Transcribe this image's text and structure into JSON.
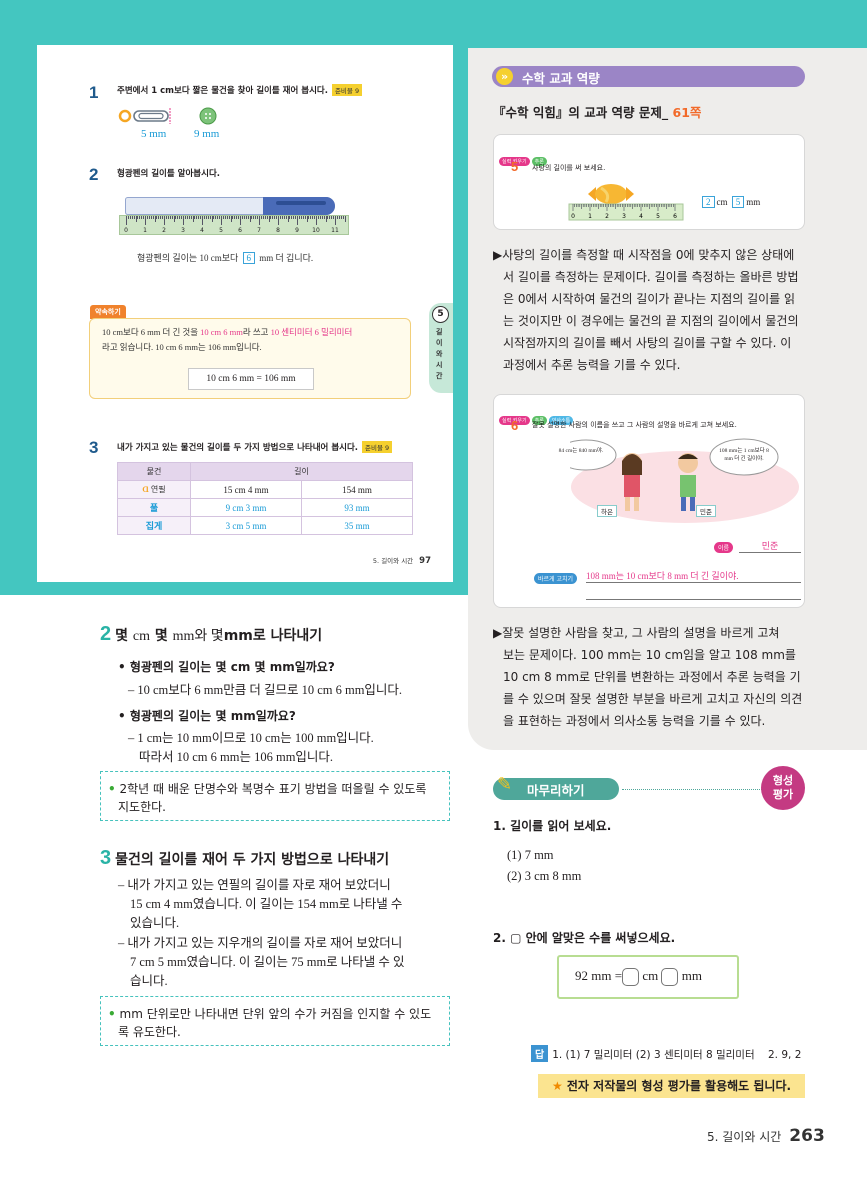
{
  "textbook": {
    "q1": {
      "num": "1",
      "text": "주변에서 1 cm보다 짧은 물건을 찾아 길이를 재어 봅시다.",
      "tag": "준비물 9",
      "label_a": "5 mm",
      "label_b": "9 mm"
    },
    "q2": {
      "num": "2",
      "text": "형광펜의 길이를 알아봅시다.",
      "ruler_numbers": [
        "0",
        "1",
        "2",
        "3",
        "4",
        "5",
        "6",
        "7",
        "8",
        "9",
        "10",
        "11"
      ],
      "sentence_pre": "형광펜의 길이는 10 cm보다",
      "sentence_box": "6",
      "sentence_post": "mm 더 깁니다."
    },
    "chapter_tab": {
      "num": "5",
      "text": "길이와시간"
    },
    "memo": {
      "tag": "약속하기",
      "line1_pre": "10 cm보다 6 mm 더 긴 것을",
      "line1_pink1": "10 cm 6 mm",
      "line1_mid": "라 쓰고",
      "line1_pink2": "10 센티미터 6 밀리미터",
      "line2": "라고 읽습니다. 10 cm 6 mm는 106 mm입니다.",
      "box": "10 cm 6 mm = 106 mm"
    },
    "q3": {
      "num": "3",
      "text": "내가 가지고 있는 물건의 길이를 두 가지 방법으로 나타내어 봅시다.",
      "tag": "준비물 9"
    },
    "table": {
      "headers": [
        "물건",
        "길이"
      ],
      "rows": [
        {
          "item": "연필",
          "a": "15 cm 4 mm",
          "b": "154 mm"
        },
        {
          "item": "풀",
          "a": "9 cm 3 mm",
          "b": "93 mm"
        },
        {
          "item": "집게",
          "a": "3 cm 5 mm",
          "b": "35 mm"
        }
      ]
    },
    "footer": {
      "chapter": "5. 길이와 시간",
      "page": "97"
    }
  },
  "left": {
    "sec2": {
      "num": "2",
      "title_a": "몇",
      "title_b": "cm",
      "title_c": "몇",
      "title_d": "mm와 몇",
      "title_e": "mm로 나타내기"
    },
    "b1": "• 형광펜의 길이는 몇 cm 몇 mm일까요?",
    "b1_ans": "– 10 cm보다 6 mm만큼 더 길므로 10 cm 6 mm입니다.",
    "b2": "• 형광펜의 길이는 몇 mm일까요?",
    "b2_ans1": "– 1 cm는 10 mm이므로 10 cm는 100 mm입니다.",
    "b2_ans2": "따라서 10 cm 6 mm는 106 mm입니다.",
    "note1_l1": "2학년 때 배운 단명수와 복명수 표기 방법을 떠올릴 수 있도록",
    "note1_l2": "지도한다.",
    "sec3": {
      "num": "3",
      "title": "물건의 길이를 재어 두 가지 방법으로 나타내기"
    },
    "s3_l1": "– 내가 가지고 있는 연필의 길이를 자로 재어 보았더니",
    "s3_l2": "15 cm 4 mm였습니다. 이 길이는 154 mm로 나타낼 수",
    "s3_l3": "있습니다.",
    "s3_l4": "– 내가 가지고 있는 지우개의 길이를 자로 재어 보았더니",
    "s3_l5": "7 cm 5 mm였습니다. 이 길이는 75 mm로 나타낼 수 있",
    "s3_l6": "습니다.",
    "note2_l1": "mm 단위로만 나타내면 단위 앞의 수가 커짐을 인지할 수 있도",
    "note2_l2": "록 유도한다."
  },
  "right": {
    "comp_label": "수학 교과 역량",
    "title_pre": "『수학 익힘』의 교과 역량 문제_",
    "title_page": "61쪽",
    "card1": {
      "num": "5",
      "tag1": "실력 키우기",
      "tag2": "추론",
      "q": "사탕의 길이를 써 보세요.",
      "ans_a": "2",
      "ans_b": "cm",
      "ans_c": "5",
      "ans_d": "mm",
      "ruler_numbers": [
        "0",
        "1",
        "2",
        "3",
        "4",
        "5",
        "6"
      ]
    },
    "para1": [
      "▶사탕의 길이를 측정할 때 시작점을 0에 맞추지 않은 상태에",
      "서 길이를 측정하는 문제이다. 길이를 측정하는 올바른 방법",
      "은 0에서 시작하여 물건의 길이가 끝나는 지점의 길이를 읽",
      "는 것이지만 이 경우에는 물건의 끝 지점의 길이에서 물건의",
      "시작점까지의 길이를 빼서 사탕의 길이를 구할 수 있다. 이",
      "과정에서 추론 능력을 기를 수 있다."
    ],
    "card2": {
      "num": "6",
      "tag1": "실력 키우기",
      "tag2": "추론",
      "tag3": "의사소통",
      "q": "잘못 설명한 사람의 이름을 쓰고 그 사람의 설명을 바르게 고쳐 보세요.",
      "bubble_a": "84 cm는 840 mm야.",
      "bubble_b": "108 mm는 1 cm보다 8 mm 더 긴 길이야.",
      "name_a": "하은",
      "name_b": "민준",
      "name_tag": "이름",
      "name_ans": "민준",
      "fix_tag": "바르게 고치기",
      "fix_ans": "108 mm는 10 cm보다 8 mm 더 긴 길이야."
    },
    "para2": [
      "▶잘못 설명한 사람을 찾고, 그 사람의 설명을 바르게 고쳐",
      "보는 문제이다. 100 mm는 10 cm임을 알고 108 mm를",
      "10 cm 8 mm로 단위를 변환하는 과정에서 추론 능력을 기",
      "를 수 있으며 잘못 설명한 부분을 바르게 고치고 자신의 의견",
      "을 표현하는 과정에서 의사소통 능력을 기를 수 있다."
    ],
    "mamuri": "마무리하기",
    "eval_badge_1": "형성",
    "eval_badge_2": "평가",
    "q1": "1. 길이를 읽어 보세요.",
    "q1_a": "(1) 7 mm",
    "q1_b": "(2) 3 cm 8 mm",
    "q2": "2. ▢ 안에 알맞은 수를 써넣으세요.",
    "fill": {
      "lhs": "92 mm =",
      "u1": "cm",
      "u2": "mm"
    },
    "answers": {
      "tag": "답",
      "text": "1. (1) 7 밀리미터 (2) 3 센티미터 8 밀리미터    2. 9, 2"
    },
    "star_note": "전자 저작물의 형성 평가를 활용해도 됩니다.",
    "page_chapter": "5. 길이와 시간",
    "page_num": "263"
  },
  "colors": {
    "teal": "#44c6c0",
    "purple": "#9b85c6",
    "orange": "#f26a2a",
    "pink": "#e5388a",
    "blue": "#1a9bd6"
  }
}
